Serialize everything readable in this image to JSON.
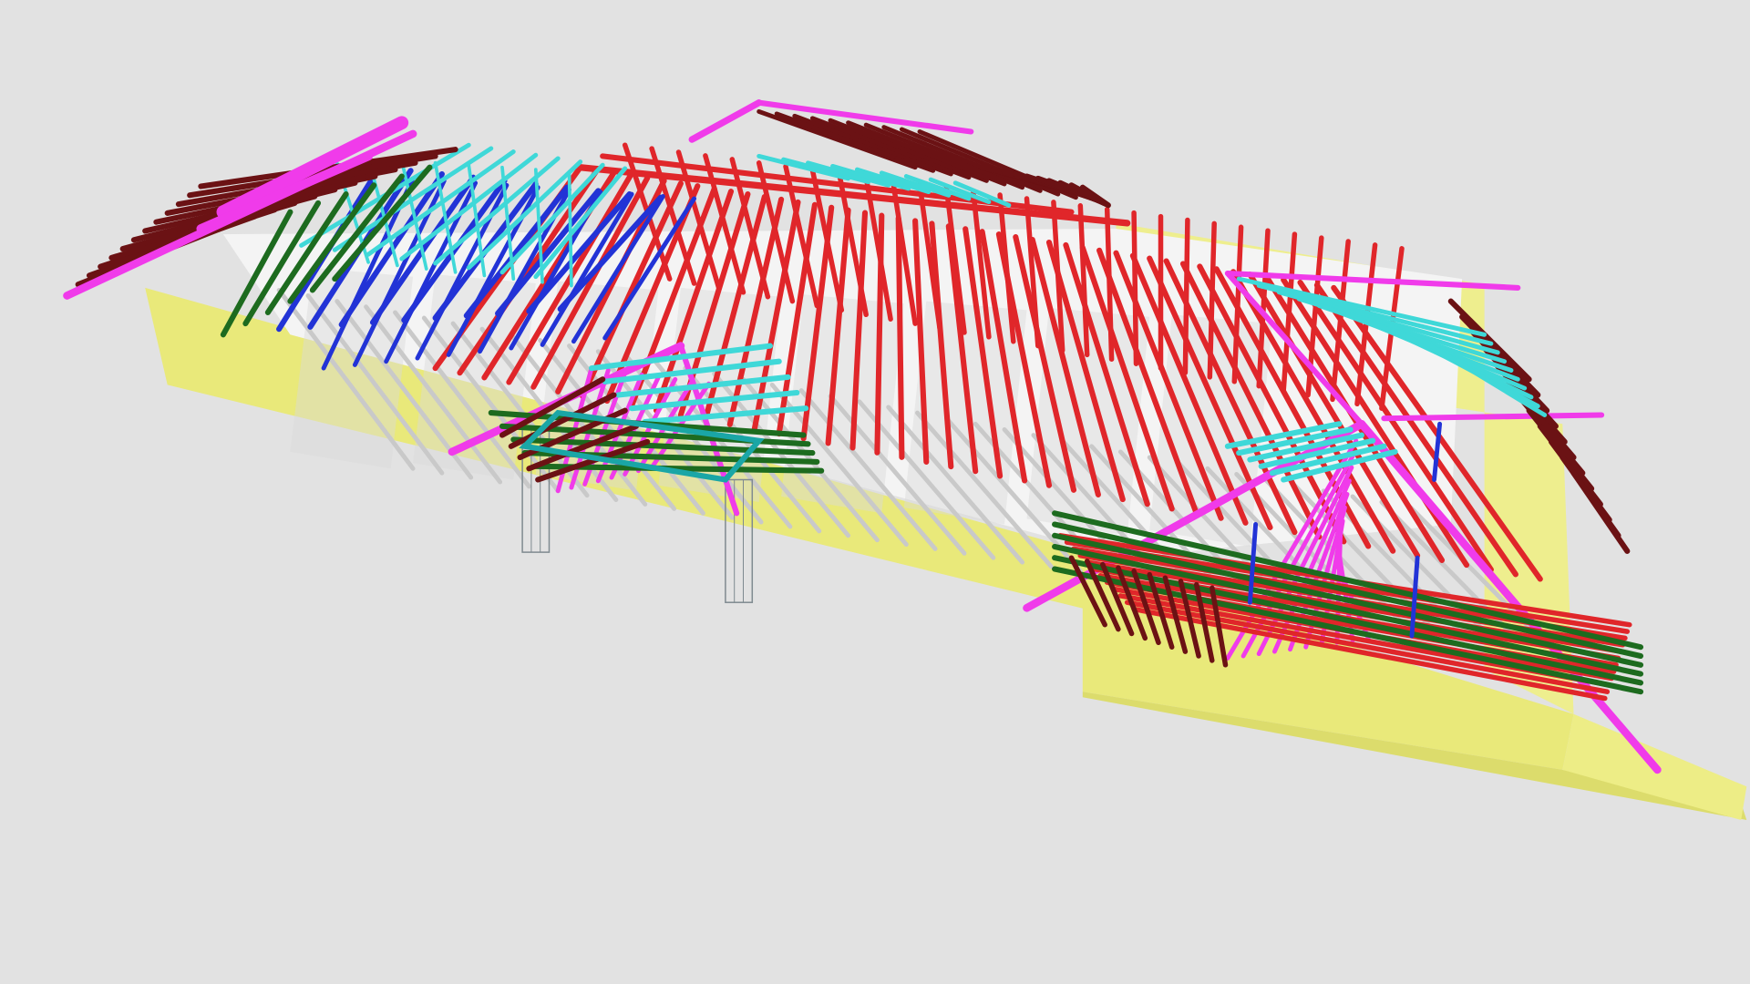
{
  "viewport": {
    "background": "#e2e2e2"
  },
  "colors": {
    "wall_side": "#e9e97a",
    "wall_top": "#f2f29a",
    "floor": "#f4f4f4",
    "floor_shade": "#d9d9d9",
    "post_outline": "#7f8a90",
    "common_rafter": "#e0262a",
    "jack_rafter": "#6b1214",
    "hip_rafter": "#f03bea",
    "valley_truss": "#3fd8d8",
    "girder_truss": "#2233d6",
    "dark_green_member": "#1d6b1f",
    "teal_member": "#1aa6a6",
    "shadow": "#c9c9c9"
  },
  "legend_semantics": [
    "common-rafter",
    "jack-rafter",
    "hip-rafter",
    "valley-truss",
    "girder-truss",
    "dark-green-member",
    "teal-member"
  ]
}
